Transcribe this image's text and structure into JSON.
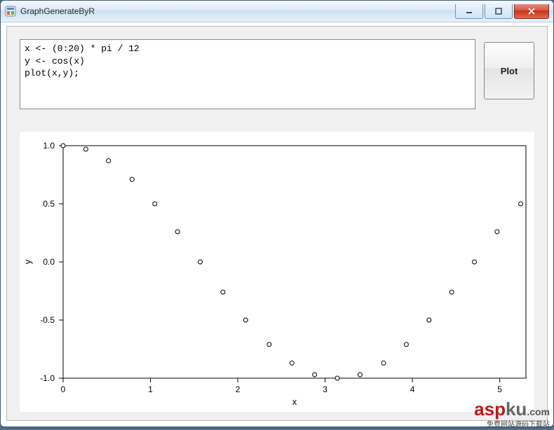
{
  "window": {
    "title": "GraphGenerateByR",
    "icon_name": "app-icon"
  },
  "window_controls": {
    "minimize": "minimize",
    "maximize": "maximize",
    "close": "close"
  },
  "editor": {
    "code": "x <- (0:20) * pi / 12\ny <- cos(x)\nplot(x,y);"
  },
  "buttons": {
    "plot": "Plot"
  },
  "chart_data": {
    "type": "scatter",
    "title": "",
    "xlabel": "x",
    "ylabel": "y",
    "xlim": [
      0,
      5.3
    ],
    "ylim": [
      -1.0,
      1.0
    ],
    "x_ticks": [
      0,
      1,
      2,
      3,
      4,
      5
    ],
    "y_ticks": [
      -1.0,
      -0.5,
      0.0,
      0.5,
      1.0
    ],
    "x": [
      0.0,
      0.26,
      0.52,
      0.79,
      1.05,
      1.31,
      1.57,
      1.83,
      2.09,
      2.36,
      2.62,
      2.88,
      3.14,
      3.4,
      3.67,
      3.93,
      4.19,
      4.45,
      4.71,
      4.97,
      5.24
    ],
    "y": [
      1.0,
      0.97,
      0.87,
      0.71,
      0.5,
      0.26,
      0.0,
      -0.26,
      -0.5,
      -0.71,
      -0.87,
      -0.97,
      -1.0,
      -0.97,
      -0.87,
      -0.71,
      -0.5,
      -0.26,
      0.0,
      0.26,
      0.5
    ]
  },
  "watermark": {
    "brand_prefix": "asp",
    "brand_suffix": "ku",
    "tld": ".com",
    "subtitle": "免费网站源码下载站"
  }
}
